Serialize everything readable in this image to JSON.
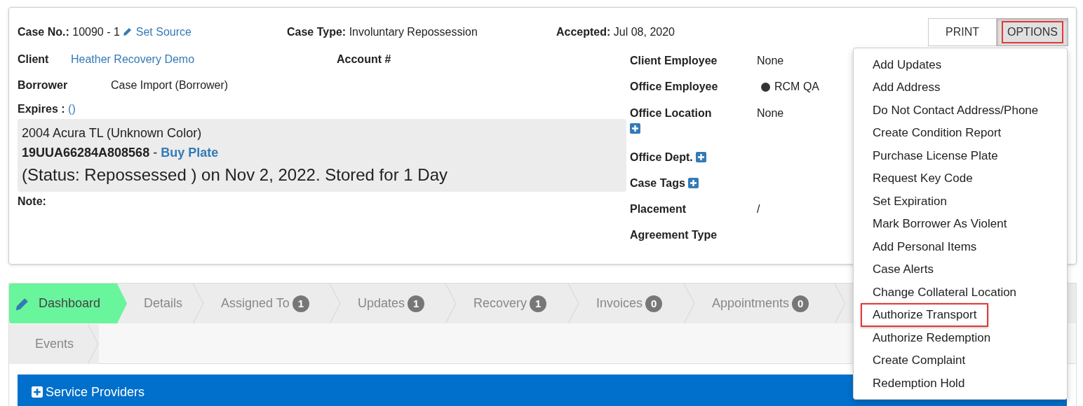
{
  "case": {
    "case_no_label": "Case No.:",
    "case_no": "10090 - 1",
    "set_source": "Set Source",
    "case_type_label": "Case Type:",
    "case_type": "Involuntary Repossession",
    "accepted_label": "Accepted:",
    "accepted": "Jul 08, 2020"
  },
  "buttons": [
    {
      "label": "PRINT",
      "highlighted": false
    },
    {
      "label": "OPTIONS",
      "highlighted": true
    }
  ],
  "left_fields": {
    "client_label": "Client",
    "client": "Heather Recovery Demo",
    "account_label": "Account #",
    "borrower_label": "Borrower",
    "borrower": "Case Import (Borrower)",
    "expires_label": "Expires :",
    "expires": "()",
    "note_label": "Note:"
  },
  "vehicle": {
    "title": "2004 Acura TL (Unknown Color)",
    "vin": "19UUA66284A808568",
    "separator": "-",
    "buy_plate": "Buy Plate",
    "status": "(Status: Repossessed ) on Nov 2, 2022. Stored for 1 Day"
  },
  "right_fields": [
    {
      "label": "Client Employee",
      "value": "None",
      "kind": "text"
    },
    {
      "label": "Office Employee",
      "value": "RCM QA",
      "kind": "dot",
      "color": "#333333"
    },
    {
      "label": "Office Location",
      "value": "None",
      "kind": "plus_below"
    },
    {
      "label": "Office Dept.",
      "kind": "plus_inline"
    },
    {
      "label": "Case Tags",
      "kind": "plus_inline"
    },
    {
      "label": "Placement",
      "value": "/",
      "kind": "text"
    },
    {
      "label": "Agreement Type",
      "kind": "text"
    }
  ],
  "tabs": [
    {
      "label": "Dashboard",
      "selected": true
    },
    {
      "label": "Details",
      "selected": false
    },
    {
      "label": "Assigned To",
      "count": "1",
      "selected": false
    },
    {
      "label": "Updates",
      "count": "1",
      "selected": false
    },
    {
      "label": "Recovery",
      "count": "1",
      "selected": false
    },
    {
      "label": "Invoices",
      "count": "0",
      "selected": false
    },
    {
      "label": "Appointments",
      "count": "0",
      "selected": false
    },
    {
      "label": "Events",
      "selected": false
    }
  ],
  "service_providers": {
    "title": "Service Providers"
  },
  "options_menu": [
    {
      "label": "Add Updates",
      "highlighted": false
    },
    {
      "label": "Add Address",
      "highlighted": false
    },
    {
      "label": "Do Not Contact Address/Phone",
      "highlighted": false
    },
    {
      "label": "Create Condition Report",
      "highlighted": false
    },
    {
      "label": "Purchase License Plate",
      "highlighted": false
    },
    {
      "label": "Request Key Code",
      "highlighted": false
    },
    {
      "label": "Set Expiration",
      "highlighted": false
    },
    {
      "label": "Mark Borrower As Violent",
      "highlighted": false
    },
    {
      "label": "Add Personal Items",
      "highlighted": false
    },
    {
      "label": "Case Alerts",
      "highlighted": false
    },
    {
      "label": "Change Collateral Location",
      "highlighted": false
    },
    {
      "label": "Authorize Transport",
      "highlighted": true
    },
    {
      "label": "Authorize Redemption",
      "highlighted": false
    },
    {
      "label": "Create Complaint",
      "highlighted": false
    },
    {
      "label": "Redemption Hold",
      "highlighted": false
    }
  ]
}
